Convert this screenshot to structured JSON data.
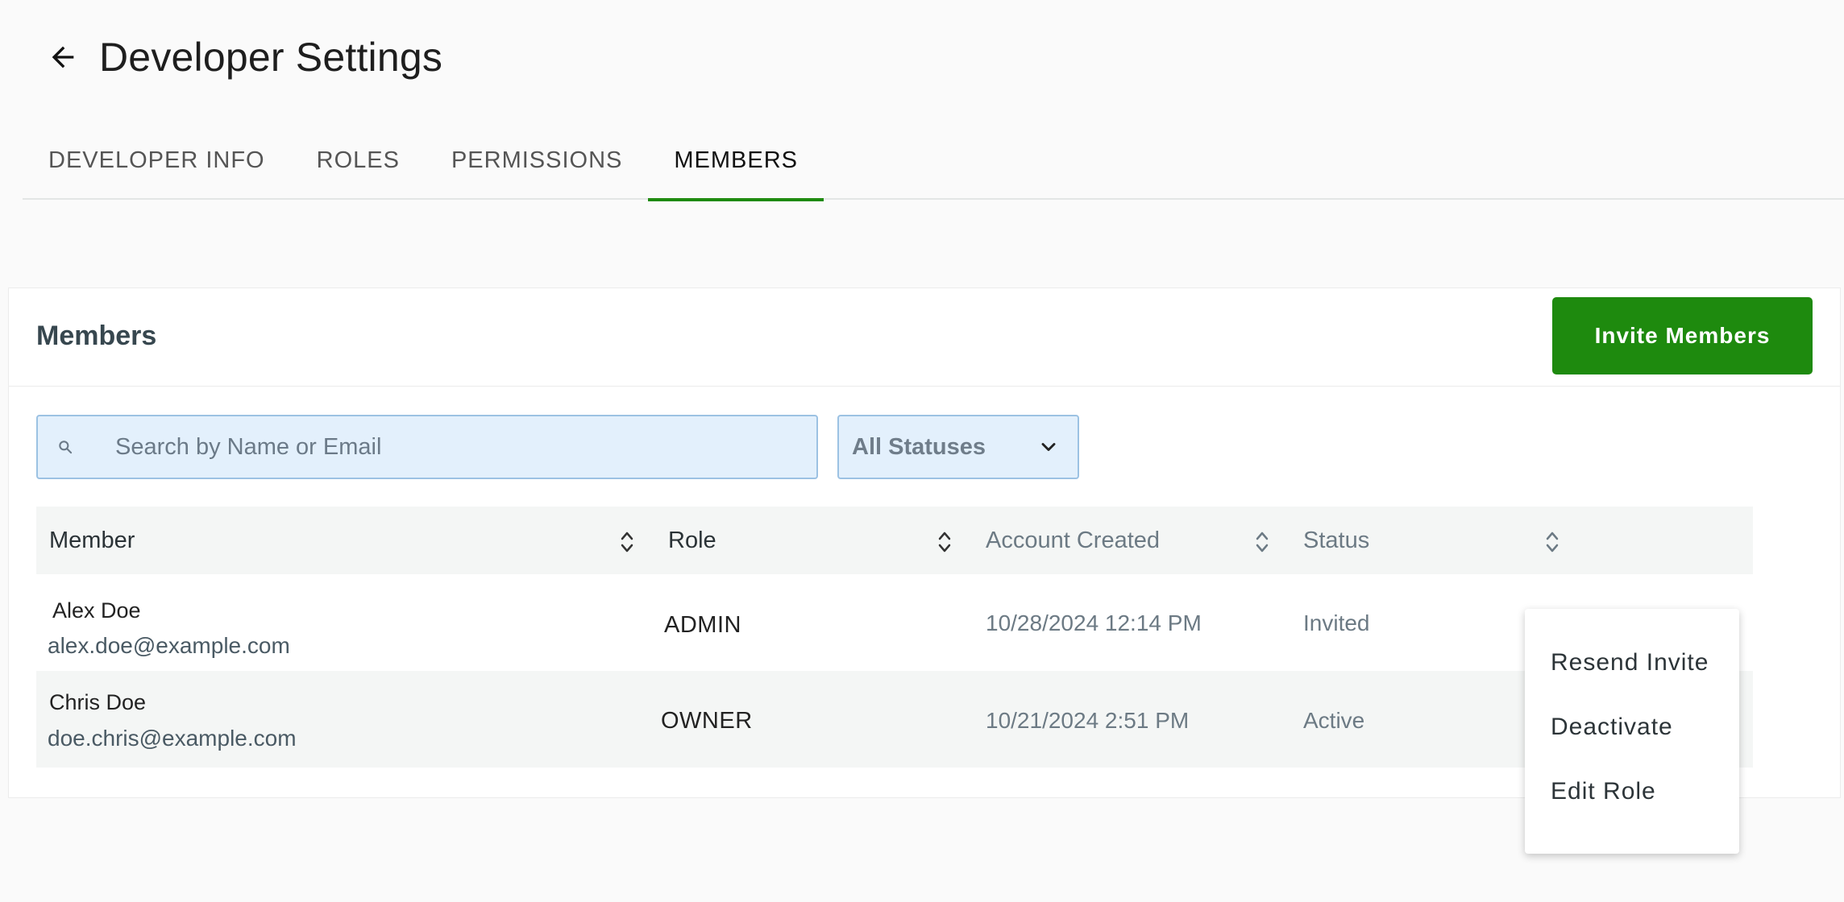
{
  "header": {
    "title": "Developer Settings"
  },
  "tabs": [
    {
      "label": "DEVELOPER INFO",
      "active": false
    },
    {
      "label": "ROLES",
      "active": false
    },
    {
      "label": "PERMISSIONS",
      "active": false
    },
    {
      "label": "MEMBERS",
      "active": true
    }
  ],
  "card": {
    "title": "Members",
    "invite_label": "Invite Members"
  },
  "filters": {
    "search_placeholder": "Search by Name or Email",
    "search_value": "",
    "status_selected": "All Statuses"
  },
  "table": {
    "columns": [
      "Member",
      "Role",
      "Account Created",
      "Status"
    ],
    "rows": [
      {
        "name": "Alex Doe",
        "email": "alex.doe@example.com",
        "role": "ADMIN",
        "created": "10/28/2024 12:14 PM",
        "status": "Invited"
      },
      {
        "name": "Chris Doe",
        "email": "doe.chris@example.com",
        "role": "OWNER",
        "created": "10/21/2024 2:51 PM",
        "status": "Active"
      }
    ]
  },
  "menu": {
    "items": [
      "Resend Invite",
      "Deactivate",
      "Edit Role"
    ]
  },
  "colors": {
    "accent": "#1e8a0e",
    "input_bg": "#e3f0fc",
    "input_border": "#9cc2e3"
  },
  "icons": [
    "back-arrow-icon",
    "search-icon",
    "chevron-down-icon",
    "sort-icon"
  ]
}
